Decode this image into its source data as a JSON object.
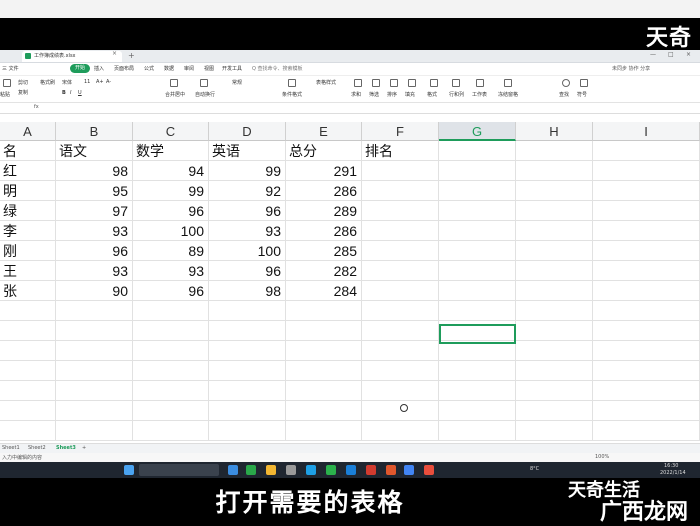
{
  "watermark": {
    "top": "天奇",
    "bottom_small": "天奇生活",
    "bottom_large": "广西龙网"
  },
  "subtitle": "打开需要的表格",
  "window": {
    "doc_tab": "工作簿成绩表.xlsx",
    "tab_close": "×",
    "tab_add": "+",
    "controls": [
      "—",
      "□",
      "×"
    ]
  },
  "menu": {
    "items": [
      "三 文件",
      "开始",
      "插入",
      "页面布局",
      "公式",
      "数据",
      "审阅",
      "视图",
      "开发工具",
      "会员专享"
    ],
    "active_index": 1,
    "search": "Q 查找命令、搜索模板",
    "right_tools": "未同步  协作  分享"
  },
  "ribbon": {
    "items": [
      "粘贴",
      "剪切",
      "复制",
      "格式刷",
      "宋体",
      "11",
      "A+",
      "A-",
      "B",
      "I",
      "U",
      "合并居中",
      "自动换行",
      "常规",
      "条件格式",
      "表格样式",
      "求和",
      "筛选",
      "排序",
      "填充",
      "格式",
      "行和列",
      "工作表",
      "冻结窗格",
      "查找",
      "符号"
    ]
  },
  "formula": {
    "fx": "fx"
  },
  "sheet": {
    "columns": [
      "A",
      "B",
      "C",
      "D",
      "E",
      "F",
      "G",
      "H",
      "I"
    ],
    "selected_column": "G",
    "header_row": [
      "名",
      "语文",
      "数学",
      "英语",
      "总分",
      "排名"
    ],
    "rows": [
      [
        "红",
        "98",
        "94",
        "99",
        "291"
      ],
      [
        "明",
        "95",
        "99",
        "92",
        "286"
      ],
      [
        "绿",
        "97",
        "96",
        "96",
        "289"
      ],
      [
        "李",
        "93",
        "100",
        "93",
        "286"
      ],
      [
        "刚",
        "96",
        "89",
        "100",
        "285"
      ],
      [
        "王",
        "93",
        "93",
        "96",
        "282"
      ],
      [
        "张",
        "90",
        "96",
        "98",
        "284"
      ]
    ]
  },
  "sheet_tabs": [
    "Sheet1",
    "Sheet2",
    "Sheet3",
    "+"
  ],
  "active_sheet": "Sheet3",
  "status": {
    "left": "入力中编辑的内容",
    "zoom": "100%"
  },
  "taskbar": {
    "weather": "8°C",
    "time": "16:30",
    "date": "2022/1/14"
  }
}
